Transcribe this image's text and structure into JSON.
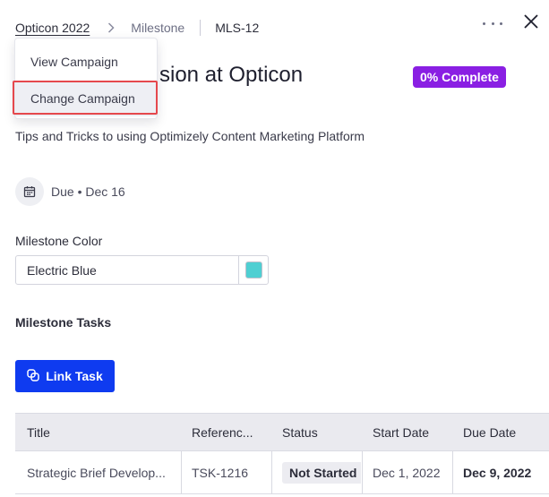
{
  "breadcrumb": {
    "campaign": "Opticon 2022",
    "section": "Milestone",
    "id": "MLS-12"
  },
  "milestone": {
    "title_visible": "sion at Opticon",
    "progress": "0% Complete",
    "progress_value": 0,
    "description": "Tips and Tricks to using Optimizely Content Marketing Platform",
    "due_label": "Due • Dec 16"
  },
  "campaign_menu": {
    "items": [
      "View Campaign",
      "Change Campaign"
    ],
    "highlighted_item": "Change Campaign"
  },
  "color_section": {
    "label": "Milestone Color",
    "value": "Electric Blue",
    "swatch_color": "#4fcfd2"
  },
  "tasks": {
    "heading": "Milestone Tasks",
    "link_button": "Link Task",
    "columns": [
      "Title",
      "Referenc...",
      "Status",
      "Start Date",
      "Due Date"
    ],
    "rows": [
      {
        "title": "Strategic Brief Develop...",
        "reference": "TSK-1216",
        "status": "Not Started",
        "start_date": "Dec 1, 2022",
        "due_date": "Dec 9, 2022"
      }
    ]
  },
  "colors": {
    "accent_blue": "#0f3bf0",
    "progress_purple": "#8a1fe3",
    "highlight_red": "#e5484d"
  },
  "icons": [
    "chevron-right-icon",
    "more-icon",
    "close-icon",
    "calendar-icon",
    "link-icon"
  ]
}
